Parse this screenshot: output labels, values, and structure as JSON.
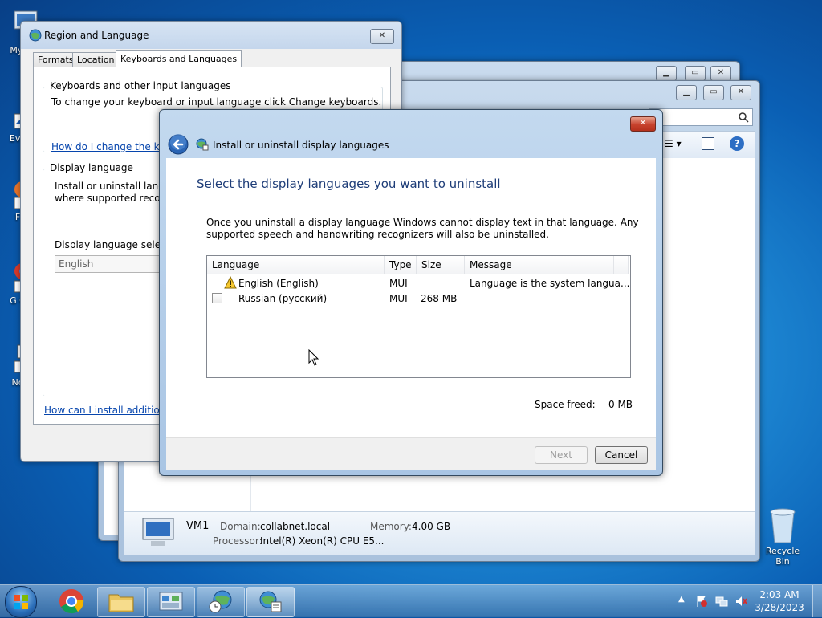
{
  "desktop": {
    "icons": [
      {
        "label": "My C"
      },
      {
        "label": "Eve"
      },
      {
        "label": "F"
      },
      {
        "label": "G C"
      },
      {
        "label": "No"
      },
      {
        "label": "Recycle Bin"
      }
    ]
  },
  "region_dialog": {
    "title": "Region and Language",
    "tabs": [
      "Formats",
      "Location",
      "Keyboards and Languages"
    ],
    "keyboards_group": "Keyboards and other input languages",
    "keyboards_text": "To change your keyboard or input language click Change keyboards.",
    "keyboards_link": "How do I change the keyb",
    "display_group": "Display language",
    "display_text_1": "Install or uninstall langua",
    "display_text_2": "where supported recogn",
    "display_select_label": "Display language selectio",
    "display_select_value": "English",
    "install_link": "How can I install additional"
  },
  "explorer": {
    "close_glyph": "✕",
    "computer_name": "VM1",
    "domain_label": "Domain:",
    "domain_value": "collabnet.local",
    "memory_label": "Memory:",
    "memory_value": "4.00 GB",
    "processor_label": "Processor:",
    "processor_value": "Intel(R) Xeon(R) CPU E5..."
  },
  "wizard": {
    "title": "Install or uninstall display languages",
    "heading": "Select the display languages you want to uninstall",
    "description": "Once you uninstall a display language Windows cannot display text in that language. Any supported speech and handwriting recognizers will also be uninstalled.",
    "columns": [
      "Language",
      "Type",
      "Size",
      "Message"
    ],
    "rows": [
      {
        "language": "English (English)",
        "type": "MUI",
        "size": "",
        "message": "Language is the system langua..."
      },
      {
        "language": "Russian (русский)",
        "type": "MUI",
        "size": "268 MB",
        "message": ""
      }
    ],
    "space_freed_label": "Space freed:",
    "space_freed_value": "0 MB",
    "next_label": "Next",
    "cancel_label": "Cancel",
    "close_glyph": "✕"
  },
  "taskbar": {
    "time": "2:03 AM",
    "date": "3/28/2023"
  },
  "colors": {
    "accent_title": "#1e3d78",
    "link": "#0645ad"
  }
}
